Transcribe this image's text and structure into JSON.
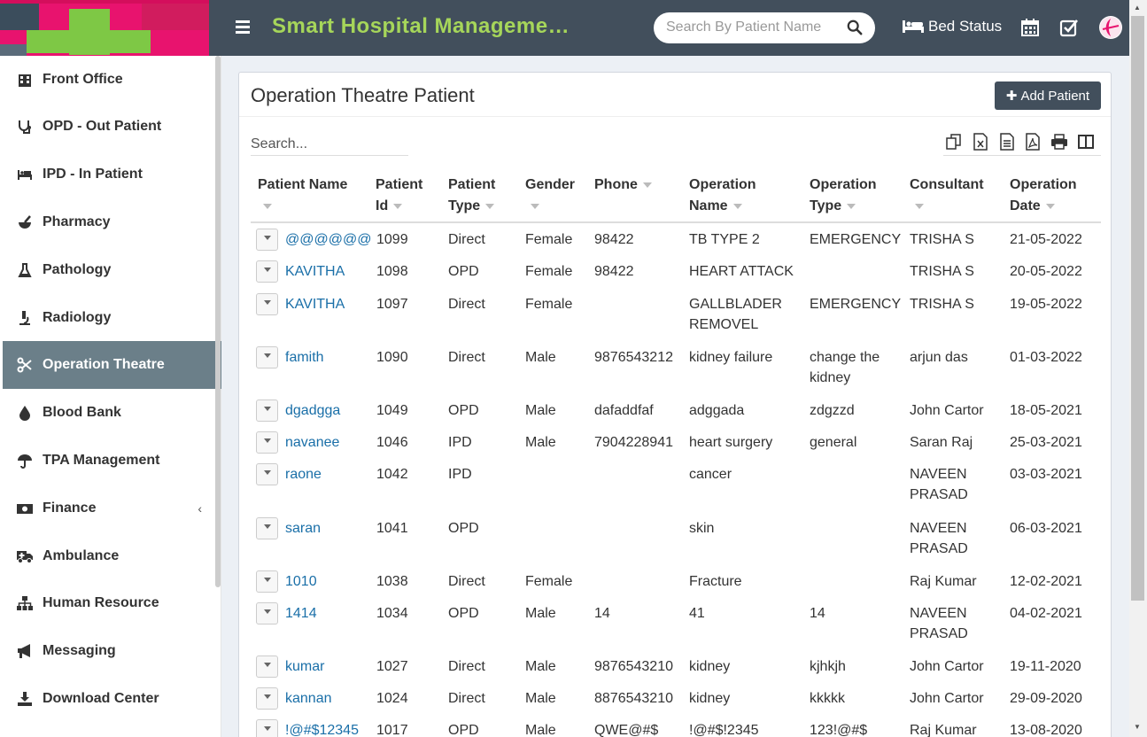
{
  "header": {
    "title": "Smart Hospital Manageme…",
    "search_placeholder": "Search By Patient Name",
    "bed_status": "Bed Status"
  },
  "sidebar": {
    "items": [
      {
        "label": "Front Office",
        "icon": "building-icon"
      },
      {
        "label": "OPD - Out Patient",
        "icon": "stethoscope-icon"
      },
      {
        "label": "IPD - In Patient",
        "icon": "bed-icon"
      },
      {
        "label": "Pharmacy",
        "icon": "mortar-pestle-icon"
      },
      {
        "label": "Pathology",
        "icon": "flask-icon"
      },
      {
        "label": "Radiology",
        "icon": "microscope-icon"
      },
      {
        "label": "Operation Theatre",
        "icon": "scissors-icon",
        "active": true
      },
      {
        "label": "Blood Bank",
        "icon": "blood-drop-icon"
      },
      {
        "label": "TPA Management",
        "icon": "umbrella-icon"
      },
      {
        "label": "Finance",
        "icon": "money-icon"
      },
      {
        "label": "Ambulance",
        "icon": "ambulance-icon"
      },
      {
        "label": "Human Resource",
        "icon": "sitemap-icon"
      },
      {
        "label": "Messaging",
        "icon": "megaphone-icon"
      },
      {
        "label": "Download Center",
        "icon": "download-icon"
      }
    ]
  },
  "panel": {
    "title": "Operation Theatre Patient",
    "add_button": "Add Patient",
    "search_placeholder": "Search..."
  },
  "table": {
    "headers": [
      [
        "Patient Name",
        ""
      ],
      [
        "Patient",
        "Id"
      ],
      [
        "Patient",
        "Type"
      ],
      [
        "Gender",
        ""
      ],
      [
        "Phone",
        ""
      ],
      [
        "Operation",
        "Name"
      ],
      [
        "Operation",
        "Type"
      ],
      [
        "Consultant",
        ""
      ],
      [
        "Operation",
        "Date"
      ]
    ],
    "rows": [
      {
        "name": "@@@@@@",
        "id": "1099",
        "type": "Direct",
        "gender": "Female",
        "phone": "98422",
        "op_name": [
          "TB TYPE 2"
        ],
        "op_type": [
          "EMERGENCY"
        ],
        "consultant": [
          "TRISHA S"
        ],
        "date": "21-05-2022"
      },
      {
        "name": "KAVITHA",
        "id": "1098",
        "type": "OPD",
        "gender": "Female",
        "phone": "98422",
        "op_name": [
          "HEART ATTACK"
        ],
        "op_type": [
          ""
        ],
        "consultant": [
          "TRISHA S"
        ],
        "date": "20-05-2022"
      },
      {
        "name": "KAVITHA",
        "id": "1097",
        "type": "Direct",
        "gender": "Female",
        "phone": "",
        "op_name": [
          "GALLBLADER",
          "REMOVEL"
        ],
        "op_type": [
          "EMERGENCY"
        ],
        "consultant": [
          "TRISHA S"
        ],
        "date": "19-05-2022"
      },
      {
        "name": "famith",
        "id": "1090",
        "type": "Direct",
        "gender": "Male",
        "phone": "9876543212",
        "op_name": [
          "kidney failure"
        ],
        "op_type": [
          "change the",
          "kidney"
        ],
        "consultant": [
          "arjun das"
        ],
        "date": "01-03-2022"
      },
      {
        "name": "dgadgga",
        "id": "1049",
        "type": "OPD",
        "gender": "Male",
        "phone": "dafaddfaf",
        "op_name": [
          "adggada"
        ],
        "op_type": [
          "zdgzzd"
        ],
        "consultant": [
          "John Cartor"
        ],
        "date": "18-05-2021"
      },
      {
        "name": "navanee",
        "id": "1046",
        "type": "IPD",
        "gender": "Male",
        "phone": "7904228941",
        "op_name": [
          "heart surgery"
        ],
        "op_type": [
          "general"
        ],
        "consultant": [
          "Saran Raj"
        ],
        "date": "25-03-2021"
      },
      {
        "name": "raone",
        "id": "1042",
        "type": "IPD",
        "gender": "",
        "phone": "",
        "op_name": [
          "cancer"
        ],
        "op_type": [
          ""
        ],
        "consultant": [
          "NAVEEN",
          "PRASAD"
        ],
        "date": "03-03-2021"
      },
      {
        "name": "saran",
        "id": "1041",
        "type": "OPD",
        "gender": "",
        "phone": "",
        "op_name": [
          "skin"
        ],
        "op_type": [
          ""
        ],
        "consultant": [
          "NAVEEN",
          "PRASAD"
        ],
        "date": "06-03-2021"
      },
      {
        "name": "1010",
        "id": "1038",
        "type": "Direct",
        "gender": "Female",
        "phone": "",
        "op_name": [
          "Fracture"
        ],
        "op_type": [
          ""
        ],
        "consultant": [
          "Raj Kumar"
        ],
        "date": "12-02-2021"
      },
      {
        "name": "1414",
        "id": "1034",
        "type": "OPD",
        "gender": "Male",
        "phone": "14",
        "op_name": [
          "41"
        ],
        "op_type": [
          "14"
        ],
        "consultant": [
          "NAVEEN",
          "PRASAD"
        ],
        "date": "04-02-2021"
      },
      {
        "name": "kumar",
        "id": "1027",
        "type": "Direct",
        "gender": "Male",
        "phone": "9876543210",
        "op_name": [
          "kidney"
        ],
        "op_type": [
          "kjhkjh"
        ],
        "consultant": [
          "John Cartor"
        ],
        "date": "19-11-2020"
      },
      {
        "name": "kannan",
        "id": "1024",
        "type": "Direct",
        "gender": "Male",
        "phone": "8876543210",
        "op_name": [
          "kidney"
        ],
        "op_type": [
          "kkkkk"
        ],
        "consultant": [
          "John Cartor"
        ],
        "date": "29-09-2020"
      },
      {
        "name": "!@#$12345",
        "id": "1017",
        "type": "OPD",
        "gender": "Male",
        "phone": "QWE@#$",
        "op_name": [
          "!@#$!2345"
        ],
        "op_type": [
          "123!@#$"
        ],
        "consultant": [
          "Raj Kumar"
        ],
        "date": "13-08-2020"
      }
    ]
  },
  "colors": {
    "topbar": "#424f5c",
    "title_green": "#a6d65a",
    "active_item": "#6b7f89",
    "link": "#1a6fa8",
    "logo_pink": "#e8136e"
  }
}
